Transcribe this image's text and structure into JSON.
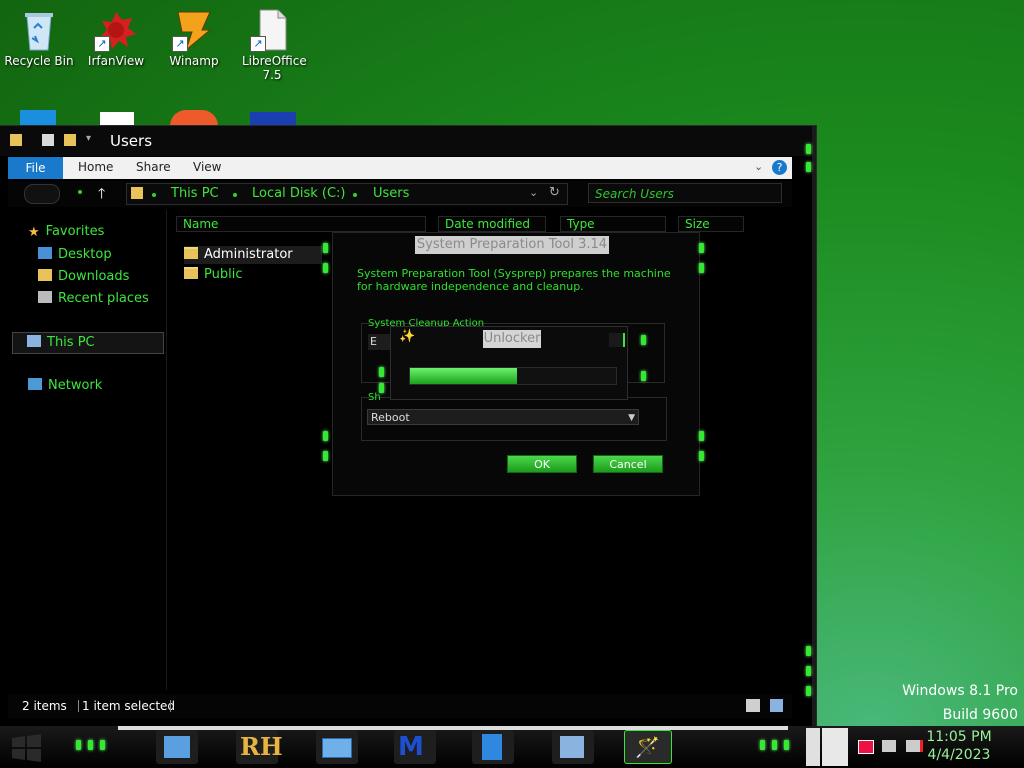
{
  "desktop": {
    "icons": [
      {
        "label": "Recycle Bin"
      },
      {
        "label": "IrfanView"
      },
      {
        "label": "Winamp"
      },
      {
        "label": "LibreOffice 7.5"
      }
    ]
  },
  "explorer": {
    "title": "Users",
    "ribbon": {
      "file": "File",
      "home": "Home",
      "share": "Share",
      "view": "View"
    },
    "address": {
      "crumbs": [
        "This PC",
        "Local Disk (C:)",
        "Users"
      ]
    },
    "search_placeholder": "Search Users",
    "nav": {
      "favorites": "Favorites",
      "desktop": "Desktop",
      "downloads": "Downloads",
      "recent": "Recent places",
      "this_pc": "This PC",
      "network": "Network"
    },
    "columns": {
      "name": "Name",
      "date": "Date modified",
      "type": "Type",
      "size": "Size"
    },
    "files": [
      {
        "name": "Administrator"
      },
      {
        "name": "Public"
      }
    ],
    "status": {
      "items": "2 items",
      "selected": "1 item selected"
    }
  },
  "sysprep": {
    "title": "System Preparation Tool 3.14",
    "description": "System Preparation Tool (Sysprep) prepares the machine for hardware independence and cleanup.",
    "cleanup_label": "System Cleanup Action",
    "cleanup_value_partial": "E",
    "shutdown_label_partial": "Sh",
    "shutdown_value": "Reboot",
    "ok": "OK",
    "cancel": "Cancel"
  },
  "unlocker": {
    "title": "Unlocker",
    "progress": 0.52
  },
  "taskbar": {
    "rh_label": "RH",
    "clock_time": "11:05 PM",
    "clock_date": "4/4/2023"
  },
  "watermark": {
    "line1": "Windows 8.1 Pro",
    "line2": "Build 9600"
  },
  "colors": {
    "accent": "#3de63d",
    "file_tab": "#1979ca"
  }
}
